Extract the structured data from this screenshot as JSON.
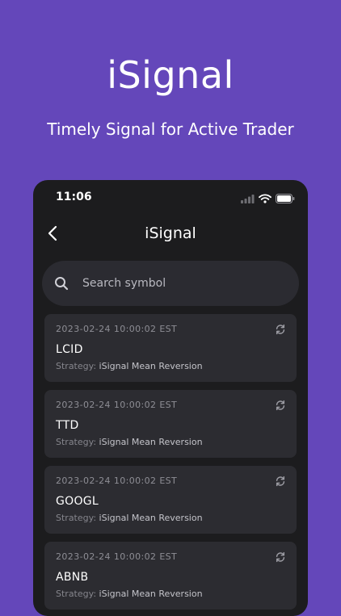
{
  "hero": {
    "title": "iSignal",
    "subtitle": "Timely Signal for Active Trader"
  },
  "status_bar": {
    "time": "11:06"
  },
  "nav": {
    "title": "iSignal"
  },
  "search": {
    "placeholder": "Search symbol"
  },
  "signals": [
    {
      "timestamp": "2023-02-24 10:00:02 EST",
      "symbol": "LCID",
      "strategy_prefix": "Strategy: ",
      "strategy_name": "iSignal Mean Reversion"
    },
    {
      "timestamp": "2023-02-24 10:00:02 EST",
      "symbol": "TTD",
      "strategy_prefix": "Strategy: ",
      "strategy_name": "iSignal Mean Reversion"
    },
    {
      "timestamp": "2023-02-24 10:00:02 EST",
      "symbol": "GOOGL",
      "strategy_prefix": "Strategy: ",
      "strategy_name": "iSignal Mean Reversion"
    },
    {
      "timestamp": "2023-02-24 10:00:02 EST",
      "symbol": "ABNB",
      "strategy_prefix": "Strategy: ",
      "strategy_name": "iSignal Mean Reversion"
    }
  ],
  "icons": {
    "back": "chevron-left-icon",
    "search": "search-icon",
    "refresh": "refresh-icon",
    "signal": "cellular-signal-icon",
    "wifi": "wifi-icon",
    "battery": "battery-icon"
  },
  "colors": {
    "background": "#6447ba",
    "phone_background": "#1c1c1e",
    "card_background": "#2c2c31",
    "search_background": "#2b2b31"
  }
}
